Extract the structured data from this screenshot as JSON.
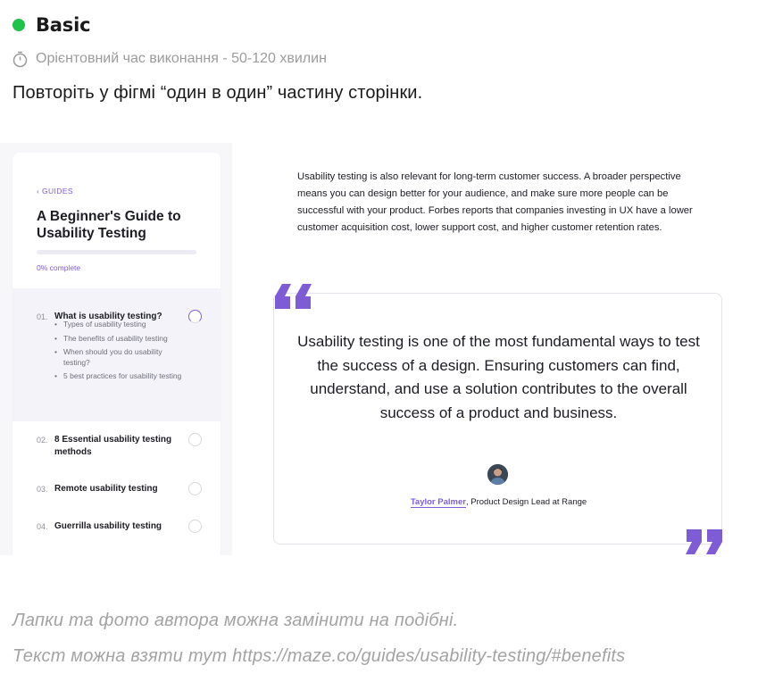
{
  "header": {
    "level_label": "Basic",
    "level_color": "#1fc24b",
    "time_icon": "stopwatch-icon",
    "time_text": "Орієнтовний час виконання - 50-120 хвилин",
    "task_text": "Повторіть у фігмі “один в один” частину сторінки."
  },
  "screenshot": {
    "sidebar": {
      "back_link": "‹  GUIDES",
      "title": "A Beginner's Guide to Usability Testing",
      "progress_percent": 0,
      "progress_text": "0% complete",
      "sections": [
        {
          "num": "01.",
          "title": "What is usability testing?",
          "status": "in-progress",
          "subitems": [
            "Types of usability testing",
            "The benefits of usability testing",
            "When should you do usability testing?",
            "5 best practices for usability testing"
          ]
        },
        {
          "num": "02.",
          "title": "8 Essential usability testing methods",
          "status": "not-started"
        },
        {
          "num": "03.",
          "title": "Remote usability testing",
          "status": "not-started"
        },
        {
          "num": "04.",
          "title": "Guerrilla usability testing",
          "status": "not-started"
        }
      ]
    },
    "content": {
      "paragraph": "Usability testing is also relevant for long-term customer success. A broader perspective means you can design better for your audience, and make sure more people can be successful with your product. Forbes reports that companies investing in UX have a lower customer acquisition cost, lower support cost, and higher customer retention rates.",
      "quote": "Usability testing is one of the most fundamental ways to test the success of a design. Ensuring customers can find, understand, and use a solution contributes to the overall success of a product and business.",
      "author_name": "Taylor Palmer",
      "author_role": ", Product Design Lead at Range",
      "accent_color": "#7d5cd6"
    }
  },
  "notes": {
    "line1": "Лапки та фото автора можна замінити на подібні.",
    "line2": "Текст можна взяти тут https://maze.co/guides/usability-testing/#benefits"
  }
}
